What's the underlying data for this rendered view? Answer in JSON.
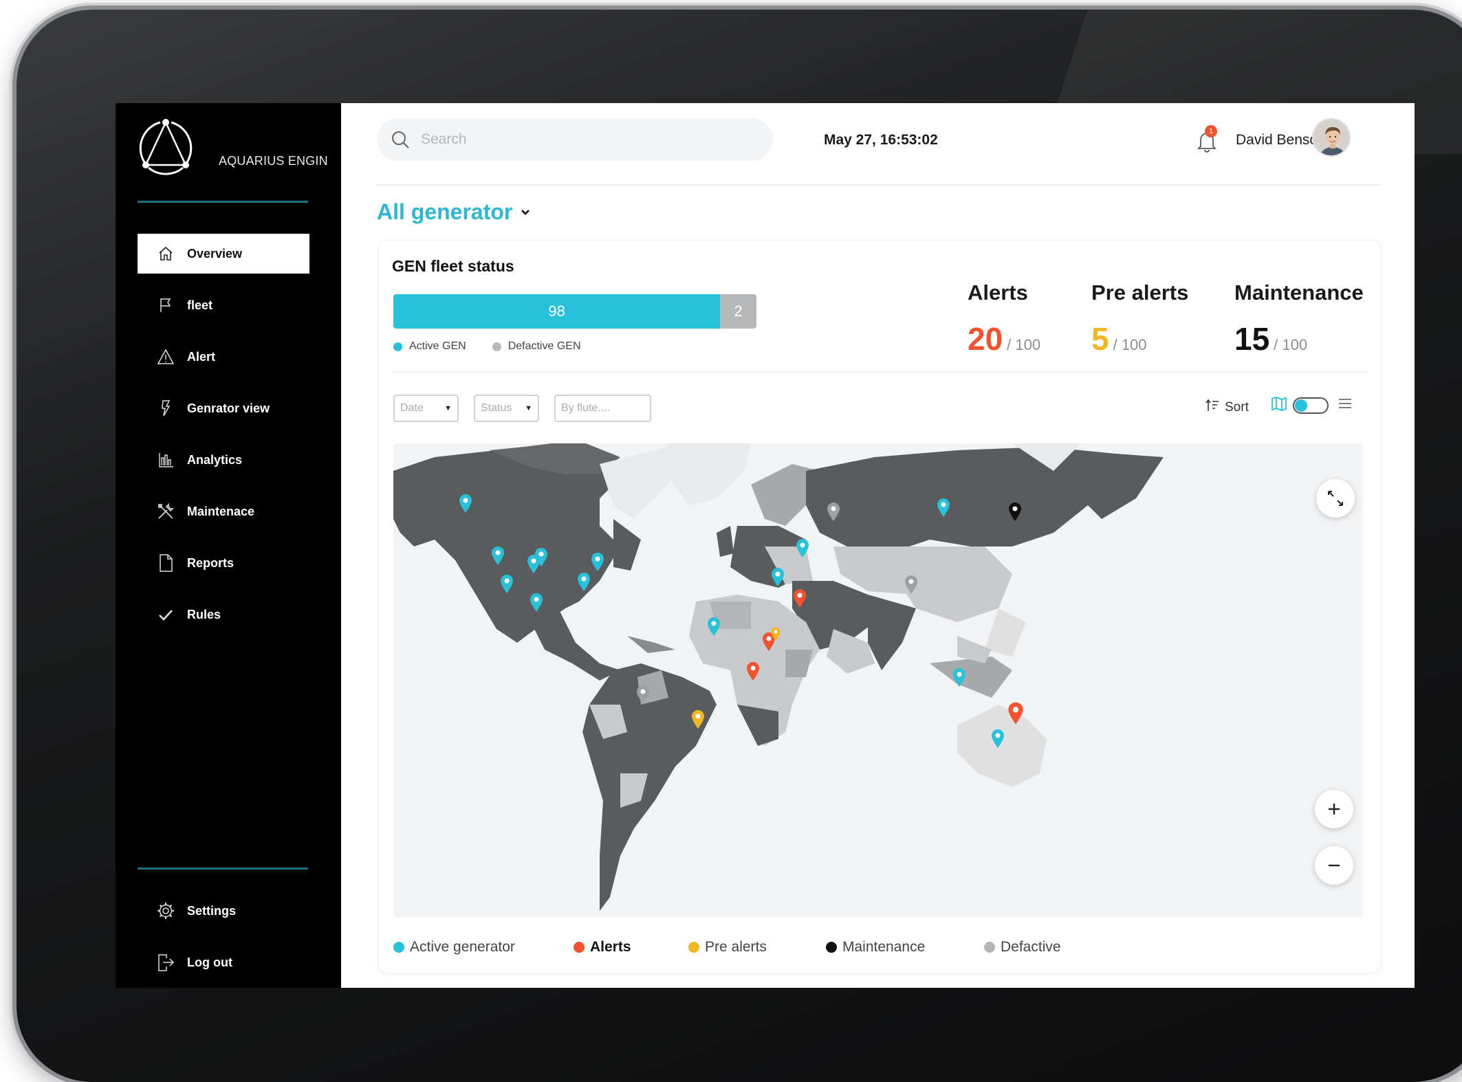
{
  "app": {
    "logo_text_bold": "AQUARIUS",
    "logo_text_light": " ENGIN"
  },
  "sidebar": {
    "items": [
      {
        "label": "Overview",
        "icon": "home-icon"
      },
      {
        "label": "fleet",
        "icon": "flag-icon"
      },
      {
        "label": "Alert",
        "icon": "warning-icon"
      },
      {
        "label": "Genrator view",
        "icon": "bolt-icon"
      },
      {
        "label": "Analytics",
        "icon": "bar-chart-icon"
      },
      {
        "label": "Maintenace",
        "icon": "tools-icon"
      },
      {
        "label": "Reports",
        "icon": "document-icon"
      },
      {
        "label": "Rules",
        "icon": "check-icon"
      }
    ],
    "active": "Overview",
    "settings_label": "Settings",
    "logout_label": "Log out"
  },
  "header": {
    "search_placeholder": "Search",
    "datetime": "May 27, 16:53:02",
    "notification_count": "1",
    "user_name": "David Benson"
  },
  "page": {
    "title": "All generator"
  },
  "fleet_status": {
    "title": "GEN fleet status",
    "active_count": "98",
    "defective_count": "2",
    "active_fraction": 0.9,
    "legend_active": "Active GEN",
    "legend_defective": "Defactive GEN"
  },
  "metrics": {
    "alerts": {
      "label": "Alerts",
      "value": "20",
      "total": "/ 100"
    },
    "pre_alerts": {
      "label": "Pre alerts",
      "value": "5",
      "total": "/ 100"
    },
    "maintenance": {
      "label": "Maintenance",
      "value": "15",
      "total": "/ 100"
    }
  },
  "filters": {
    "date": "Date",
    "status": "Status",
    "by_flute_placeholder": "By flute....",
    "sort_label": "Sort",
    "map_view_on": true
  },
  "map_legend": [
    {
      "label": "Active generator",
      "color": "#28c1da",
      "bold": false
    },
    {
      "label": "Alerts",
      "color": "#f2522e",
      "bold": true
    },
    {
      "label": "Pre alerts",
      "color": "#f2b622",
      "bold": false
    },
    {
      "label": "Maintenance",
      "color": "#111111",
      "bold": false
    },
    {
      "label": "Defactive",
      "color": "#b3b5b7",
      "bold": false
    }
  ],
  "colors": {
    "accent": "#28c1da",
    "title_accent": "#2cb7d4",
    "alert": "#f2522e",
    "pre_alert": "#f2b622",
    "maintenance": "#111111",
    "defective": "#b3b5b7"
  }
}
